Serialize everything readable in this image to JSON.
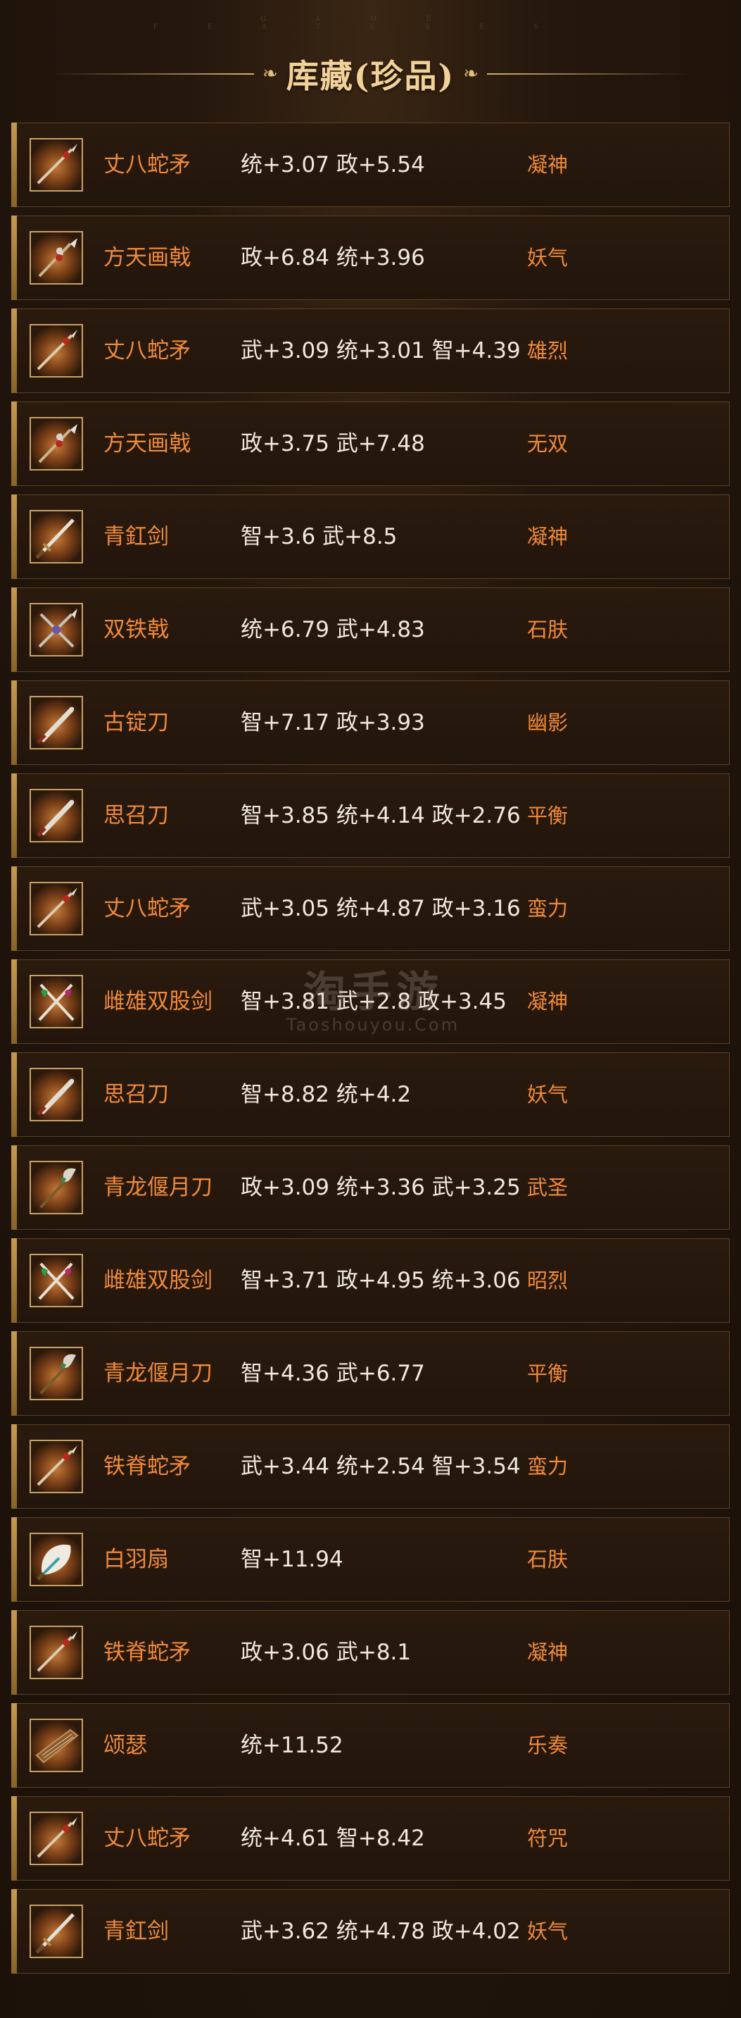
{
  "header": {
    "deco_text": "GAME FEATURES",
    "title": "库藏(珍品)",
    "ornament_left": "❧",
    "ornament_right": "❧"
  },
  "watermark": {
    "line1": "淘手游",
    "line2": "Taoshouyou.Com"
  },
  "items": [
    {
      "name": "丈八蛇矛",
      "stats": "统+3.07 政+5.54",
      "trait": "凝神",
      "icon": "spear-icon"
    },
    {
      "name": "方天画戟",
      "stats": "政+6.84 统+3.96",
      "trait": "妖气",
      "icon": "halberd-icon"
    },
    {
      "name": "丈八蛇矛",
      "stats": "武+3.09 统+3.01 智+4.39",
      "trait": "雄烈",
      "icon": "spear-icon"
    },
    {
      "name": "方天画戟",
      "stats": "政+3.75 武+7.48",
      "trait": "无双",
      "icon": "halberd-icon"
    },
    {
      "name": "青釭剑",
      "stats": "智+3.6 武+8.5",
      "trait": "凝神",
      "icon": "sword-icon"
    },
    {
      "name": "双铁戟",
      "stats": "统+6.79 武+4.83",
      "trait": "石肤",
      "icon": "twin-halberd-icon"
    },
    {
      "name": "古锭刀",
      "stats": "智+7.17 政+3.93",
      "trait": "幽影",
      "icon": "blade-icon"
    },
    {
      "name": "思召刀",
      "stats": "智+3.85 统+4.14 政+2.76",
      "trait": "平衡",
      "icon": "blade-icon"
    },
    {
      "name": "丈八蛇矛",
      "stats": "武+3.05 统+4.87 政+3.16",
      "trait": "蛮力",
      "icon": "spear-icon"
    },
    {
      "name": "雌雄双股剑",
      "stats": "智+3.81 武+2.8 政+3.45",
      "trait": "凝神",
      "icon": "twin-sword-icon"
    },
    {
      "name": "思召刀",
      "stats": "智+8.82 统+4.2",
      "trait": "妖气",
      "icon": "blade-icon"
    },
    {
      "name": "青龙偃月刀",
      "stats": "政+3.09 统+3.36 武+3.25",
      "trait": "武圣",
      "icon": "glaive-icon"
    },
    {
      "name": "雌雄双股剑",
      "stats": "智+3.71 政+4.95 统+3.06",
      "trait": "昭烈",
      "icon": "twin-sword-icon"
    },
    {
      "name": "青龙偃月刀",
      "stats": "智+4.36 武+6.77",
      "trait": "平衡",
      "icon": "glaive-icon"
    },
    {
      "name": "铁脊蛇矛",
      "stats": "武+3.44 统+2.54 智+3.54",
      "trait": "蛮力",
      "icon": "spear-icon"
    },
    {
      "name": "白羽扇",
      "stats": "智+11.94",
      "trait": "石肤",
      "icon": "feather-fan-icon"
    },
    {
      "name": "铁脊蛇矛",
      "stats": "政+3.06 武+8.1",
      "trait": "凝神",
      "icon": "spear-icon"
    },
    {
      "name": "颂瑟",
      "stats": "统+11.52",
      "trait": "乐奏",
      "icon": "zither-icon"
    },
    {
      "name": "丈八蛇矛",
      "stats": "统+4.61 智+8.42",
      "trait": "符咒",
      "icon": "spear-icon"
    },
    {
      "name": "青釭剑",
      "stats": "武+3.62 统+4.78 政+4.02",
      "trait": "妖气",
      "icon": "sword-icon"
    }
  ]
}
